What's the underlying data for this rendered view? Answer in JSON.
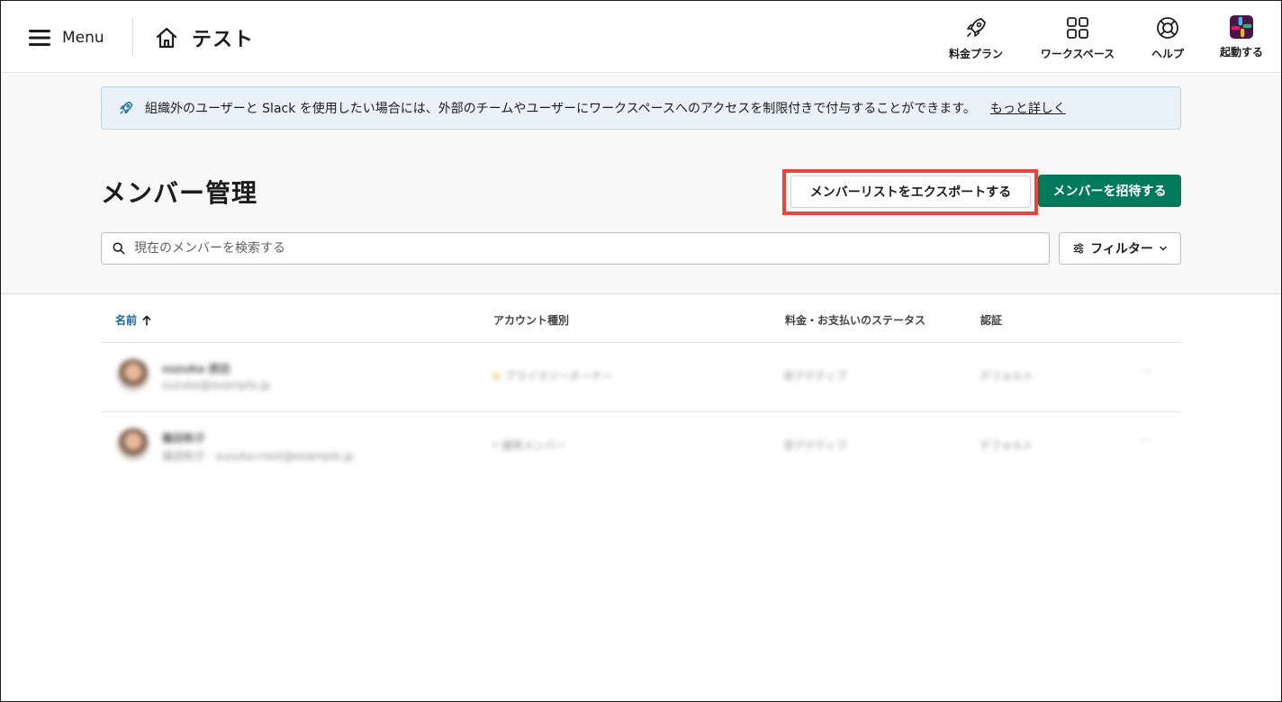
{
  "header": {
    "menu_label": "Menu",
    "workspace_name": "テスト",
    "nav": [
      {
        "label": "料金プラン",
        "icon": "rocket-icon"
      },
      {
        "label": "ワークスペース",
        "icon": "grid-icon"
      },
      {
        "label": "ヘルプ",
        "icon": "lifebuoy-icon"
      },
      {
        "label": "起動する",
        "icon": "slack-logo-icon"
      }
    ]
  },
  "banner": {
    "text": "組織外のユーザーと Slack を使用したい場合には、外部のチームやユーザーにワークスペースへのアクセスを制限付きで付与することができます。",
    "link": "もっと詳しく"
  },
  "page": {
    "title": "メンバー管理",
    "export_label": "メンバーリストをエクスポートする",
    "invite_label": "メンバーを招待する"
  },
  "search": {
    "placeholder": "現在のメンバーを検索する",
    "value": ""
  },
  "filter_label": "フィルター",
  "table": {
    "columns": [
      "名前",
      "アカウント種別",
      "料金・お支払いのステータス",
      "認証"
    ],
    "rows": [
      {
        "name": "suzuka 原田",
        "email": "suzuka@example.jp",
        "account": "プライマリーオーナー",
        "billing": "非アクティブ",
        "auth": "デフォルト"
      },
      {
        "name": "篠田和子",
        "email": "篠田和子 · suzuka+test@example.jp",
        "account": "通常メンバー",
        "billing": "非アクティブ",
        "auth": "デフォルト"
      }
    ]
  },
  "colors": {
    "primary": "#007a5a",
    "highlight": "#e8463a",
    "link": "#1264a3"
  }
}
